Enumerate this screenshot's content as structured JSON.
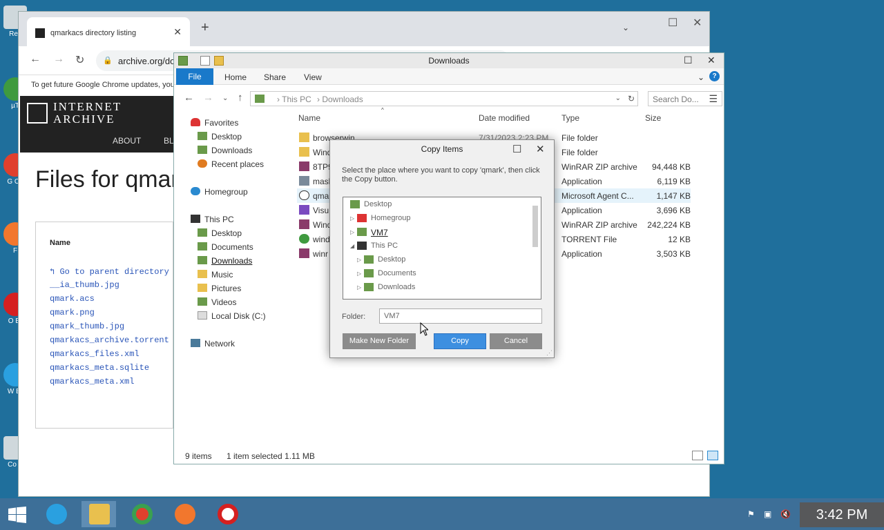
{
  "colors": {
    "desktop": "#1f6f9c",
    "accent_blue": "#1979ca",
    "link_blue": "#2a55b8",
    "folder_yellow": "#e9c04e",
    "taskbar": "#3d6f98"
  },
  "desktop_icons": [
    "Rec",
    "µT",
    "G Ch",
    "F",
    "O Br",
    "W Br",
    "Co F"
  ],
  "chrome": {
    "tab_title": "qmarkacs directory listing",
    "url": "archive.org/download/qmarkacs",
    "info_text": "To get future Google Chrome updates, you",
    "ia_line1": "INTERNET",
    "ia_line2": "ARCHIVE",
    "nav_about": "ABOUT",
    "nav_bl": "BL",
    "files_title": "Files for qmarkacs",
    "name_header": "Name",
    "files": [
      "Go to parent directory",
      "__ia_thumb.jpg",
      "qmark.acs",
      "qmark.png",
      "qmark_thumb.jpg",
      "qmarkacs_archive.torrent",
      "qmarkacs_files.xml",
      "qmarkacs_meta.sqlite",
      "qmarkacs_meta.xml"
    ]
  },
  "explorer": {
    "title": "Downloads",
    "ribbon": {
      "file": "File",
      "home": "Home",
      "share": "Share",
      "view": "View",
      "help": "?"
    },
    "breadcrumb": [
      "This PC",
      "Downloads"
    ],
    "search_placeholder": "Search Do...",
    "nav": {
      "favorites": "Favorites",
      "desktop": "Desktop",
      "downloads": "Downloads",
      "recent": "Recent places",
      "homegroup": "Homegroup",
      "thispc": "This PC",
      "pc_desktop": "Desktop",
      "pc_documents": "Documents",
      "pc_downloads": "Downloads",
      "pc_music": "Music",
      "pc_pictures": "Pictures",
      "pc_videos": "Videos",
      "pc_local": "Local Disk (C:)",
      "network": "Network"
    },
    "columns": {
      "name": "Name",
      "date": "Date modified",
      "type": "Type",
      "size": "Size"
    },
    "rows": [
      {
        "name": "browserwin",
        "date": "7/31/2023 2:23 PM",
        "type": "File folder",
        "size": "",
        "icon": "folder"
      },
      {
        "name": "Wind",
        "date": "",
        "type": "File folder",
        "size": "",
        "icon": "folder"
      },
      {
        "name": "8TP9",
        "date": "",
        "type": "WinRAR ZIP archive",
        "size": "94,448 KB",
        "icon": "zip"
      },
      {
        "name": "mash",
        "date": "",
        "type": "Application",
        "size": "6,119 KB",
        "icon": "app"
      },
      {
        "name": "qma",
        "date": "",
        "type": "Microsoft Agent C...",
        "size": "1,147 KB",
        "icon": "agent"
      },
      {
        "name": "Visu",
        "date": "",
        "type": "Application",
        "size": "3,696 KB",
        "icon": "vs"
      },
      {
        "name": "Wind",
        "date": "",
        "type": "WinRAR ZIP archive",
        "size": "242,224 KB",
        "icon": "zip"
      },
      {
        "name": "wind",
        "date": "",
        "type": "TORRENT File",
        "size": "12 KB",
        "icon": "torrent"
      },
      {
        "name": "winr",
        "date": "",
        "type": "Application",
        "size": "3,503 KB",
        "icon": "zip"
      }
    ],
    "status_count": "9 items",
    "status_selected": "1 item selected  1.11 MB"
  },
  "dialog": {
    "title": "Copy Items",
    "description": "Select the place where you want to copy 'qmark', then click the Copy button.",
    "tree": {
      "desktop": "Desktop",
      "homegroup": "Homegroup",
      "vm7": "VM7",
      "thispc": "This PC",
      "pc_desktop": "Desktop",
      "pc_documents": "Documents",
      "pc_downloads": "Downloads"
    },
    "folder_label": "Folder:",
    "folder_value": "VM7",
    "make_folder": "Make New Folder",
    "copy": "Copy",
    "cancel": "Cancel"
  },
  "taskbar": {
    "clock": "3:42 PM",
    "apps": [
      "start",
      "internet-explorer",
      "file-explorer",
      "chrome",
      "firefox",
      "opera"
    ]
  }
}
